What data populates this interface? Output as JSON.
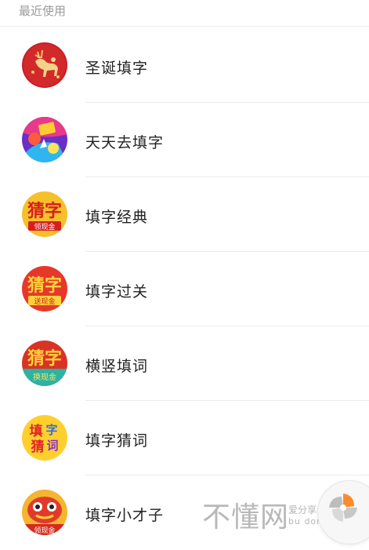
{
  "section": {
    "title": "最近使用"
  },
  "items": [
    {
      "label": "圣诞填字",
      "icon": "christmas-reindeer-icon"
    },
    {
      "label": "天天去填字",
      "icon": "colorful-party-icon"
    },
    {
      "label": "填字经典",
      "icon": "cai-zi-red-icon",
      "icon_text": {
        "main": "猜字",
        "sub": "领现金"
      }
    },
    {
      "label": "填字过关",
      "icon": "cai-zi-orange-icon",
      "icon_text": {
        "main": "猜字",
        "sub": "送现金"
      }
    },
    {
      "label": "横竖填词",
      "icon": "cai-zi-teal-icon",
      "icon_text": {
        "main": "猜字",
        "sub": "换现金"
      }
    },
    {
      "label": "填字猜词",
      "icon": "tian-zi-cai-ci-icon",
      "icon_text": {
        "c1": "填",
        "c2": "字",
        "c3": "猜",
        "c4": "词"
      }
    },
    {
      "label": "填字小才子",
      "icon": "lion-dance-icon",
      "icon_text": {
        "sub": "领现金"
      }
    }
  ],
  "watermark": {
    "main": "不懂网",
    "sub1": "爱分享",
    "sub2": "bu dong wang"
  },
  "colors": {
    "text": "#222222",
    "muted": "#9a9a9a",
    "divider": "#ebebeb",
    "red": "#d62a20",
    "yellow": "#ffd23a"
  }
}
